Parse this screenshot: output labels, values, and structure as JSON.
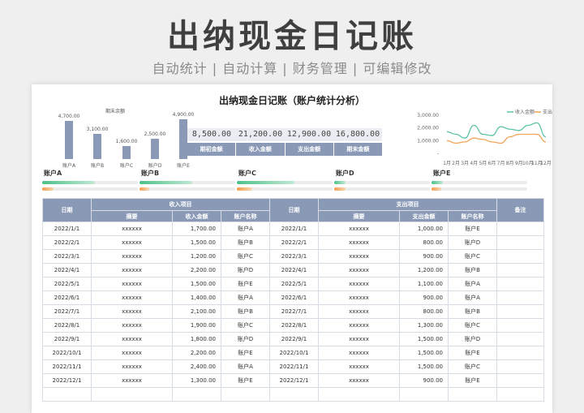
{
  "banner": {
    "title": "出纳现金日记账",
    "subtitle": "自动统计 | 自动计算 | 财务管理 | 可编辑修改"
  },
  "sheet": {
    "title": "出纳现金日记账（账户统计分析）"
  },
  "chart_data": [
    {
      "type": "bar",
      "title": "期末余额",
      "categories": [
        "账户A",
        "账户B",
        "账户C",
        "账户D",
        "账户E"
      ],
      "values": [
        4700,
        3100,
        1600,
        2500,
        4900
      ],
      "value_labels": [
        "4,700.00",
        "3,100.00",
        "1,600.00",
        "2,500.00",
        "4,900.00"
      ],
      "ylim": [
        0,
        5000
      ],
      "color": "#8a9ab6"
    },
    {
      "type": "line",
      "categories": [
        "1月",
        "2月",
        "3月",
        "4月",
        "5月",
        "6月",
        "7月",
        "8月",
        "9月",
        "10月",
        "11月",
        "12月"
      ],
      "series": [
        {
          "name": "收入金额",
          "values": [
            1700,
            1500,
            1200,
            2200,
            1500,
            1400,
            2100,
            1900,
            1800,
            2200,
            2400,
            1300
          ],
          "color": "#5dc3a8"
        },
        {
          "name": "支出金额",
          "values": [
            1000,
            800,
            900,
            1200,
            1100,
            900,
            800,
            1300,
            1500,
            1500,
            1500,
            900
          ],
          "color": "#f0a457"
        }
      ],
      "yticks": [
        "3,000.00",
        "2,000.00",
        "1,000.00",
        "-"
      ],
      "ylim": [
        0,
        3000
      ],
      "legend": "top-right"
    }
  ],
  "summary": {
    "values": [
      "8,500.00",
      "21,200.00",
      "12,900.00",
      "16,800.00"
    ],
    "labels": [
      "期初金额",
      "收入金额",
      "支出金额",
      "期末金额"
    ]
  },
  "accounts": [
    {
      "name": "账户A",
      "in": 0.55,
      "out": 0.12
    },
    {
      "name": "账户B",
      "in": 0.55,
      "out": 0.1
    },
    {
      "name": "账户C",
      "in": 0.6,
      "out": 0.16
    },
    {
      "name": "账户D",
      "in": 0.12,
      "out": 0.12
    },
    {
      "name": "账户E",
      "in": 0.12,
      "out": 0.1
    }
  ],
  "table": {
    "headers": {
      "date": "日期",
      "income_group": "收入项目",
      "expense_group": "支出项目",
      "remark": "备注",
      "summary": "摘要",
      "income_amount": "收入金额",
      "expense_amount": "支出金额",
      "account_name": "账户名称"
    },
    "rows": [
      [
        "2022/1/1",
        "xxxxxx",
        "1,700.00",
        "账户A",
        "2022/1/1",
        "xxxxxx",
        "1,000.00",
        "账户E",
        ""
      ],
      [
        "2022/2/1",
        "xxxxxx",
        "1,500.00",
        "账户B",
        "2022/2/1",
        "xxxxxx",
        "800.00",
        "账户D",
        ""
      ],
      [
        "2022/3/1",
        "xxxxxx",
        "1,200.00",
        "账户C",
        "2022/3/1",
        "xxxxxx",
        "900.00",
        "账户C",
        ""
      ],
      [
        "2022/4/1",
        "xxxxxx",
        "2,200.00",
        "账户D",
        "2022/4/1",
        "xxxxxx",
        "1,200.00",
        "账户B",
        ""
      ],
      [
        "2022/5/1",
        "xxxxxx",
        "1,500.00",
        "账户E",
        "2022/5/1",
        "xxxxxx",
        "1,100.00",
        "账户A",
        ""
      ],
      [
        "2022/6/1",
        "xxxxxx",
        "1,400.00",
        "账户A",
        "2022/6/1",
        "xxxxxx",
        "900.00",
        "账户A",
        ""
      ],
      [
        "2022/7/1",
        "xxxxxx",
        "2,100.00",
        "账户B",
        "2022/7/1",
        "xxxxxx",
        "800.00",
        "账户B",
        ""
      ],
      [
        "2022/8/1",
        "xxxxxx",
        "1,900.00",
        "账户C",
        "2022/8/1",
        "xxxxxx",
        "1,300.00",
        "账户C",
        ""
      ],
      [
        "2022/9/1",
        "xxxxxx",
        "1,800.00",
        "账户D",
        "2022/9/1",
        "xxxxxx",
        "1,500.00",
        "账户D",
        ""
      ],
      [
        "2022/10/1",
        "xxxxxx",
        "2,200.00",
        "账户E",
        "2022/10/1",
        "xxxxxx",
        "1,500.00",
        "账户E",
        ""
      ],
      [
        "2022/11/1",
        "xxxxxx",
        "2,400.00",
        "账户A",
        "2022/11/1",
        "xxxxxx",
        "1,500.00",
        "账户C",
        ""
      ],
      [
        "2022/12/1",
        "xxxxxx",
        "1,300.00",
        "账户E",
        "2022/12/1",
        "xxxxxx",
        "900.00",
        "账户E",
        ""
      ],
      [
        "",
        "",
        "",
        "",
        "",
        "",
        "",
        "",
        ""
      ]
    ]
  }
}
